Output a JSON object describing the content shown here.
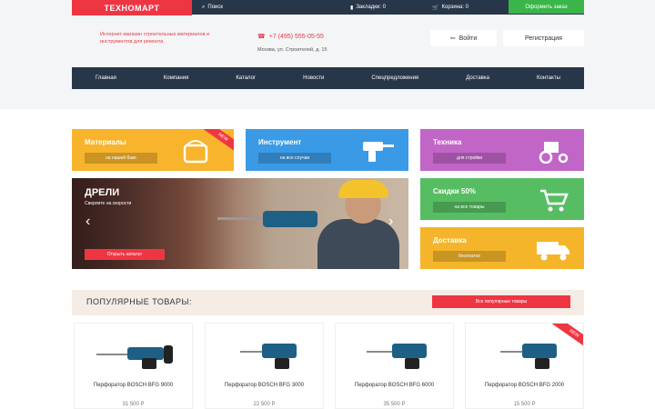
{
  "header": {
    "logo": "ТЕХНОМАРТ",
    "search_label": "Поиск",
    "favorites_label": "Закладки: 0",
    "cart_label": "Корзина: 0",
    "checkout_label": "Оформить заказ",
    "tagline": "Интернет-магазин строительных материалов и инструментов для ремонта",
    "phone": "+7 (495) 555-05-55",
    "address": "Москва, ул. Строителей, д. 15",
    "login_label": "Войти",
    "register_label": "Регистрация"
  },
  "nav": {
    "items": [
      "Главная",
      "Компания",
      "Каталог",
      "Новости",
      "Спецпредложения",
      "Доставка",
      "Контакты"
    ]
  },
  "tiles": {
    "materials": {
      "title": "Материалы",
      "button": "на нашей базе",
      "color": "#f7b42c"
    },
    "tools": {
      "title": "Инструмент",
      "button": "на все случаи",
      "color": "#3b9ae5"
    },
    "tech": {
      "title": "Техника",
      "button": "для стройки",
      "color": "#c165c7"
    },
    "discounts": {
      "title": "Скидки 50%",
      "button": "на все товары",
      "color": "#57bd63"
    },
    "delivery": {
      "title": "Доставка",
      "button": "бесплатно",
      "color": "#f4b52a"
    }
  },
  "badges": {
    "new_label": "NEW"
  },
  "slider": {
    "title": "ДРЕЛИ",
    "subtitle": "Сверлите на скорости",
    "button": "Открыть каталог"
  },
  "popular": {
    "title": "ПОПУЛЯРНЫЕ ТОВАРЫ:",
    "button": "Все популярные товары"
  },
  "products": [
    {
      "name": "Перфоратор BOSCH BFG 9000",
      "price": "31 500 Р"
    },
    {
      "name": "Перфоратор BOSCH BFG 3000",
      "price": "22 500 Р"
    },
    {
      "name": "Перфоратор BOSCH BFG 6000",
      "price": "35 500 Р"
    },
    {
      "name": "Перфоратор BOSCH BFG 2000",
      "price": "15 500 Р"
    }
  ]
}
